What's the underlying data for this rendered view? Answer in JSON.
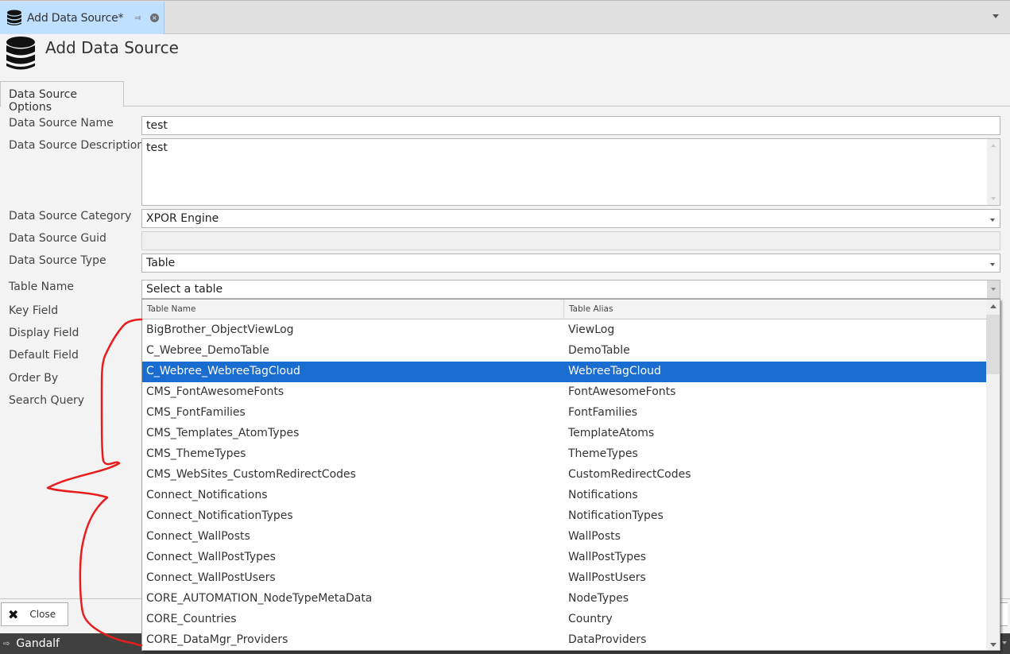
{
  "window_tab": {
    "label": "Add Data Source*",
    "icon": "database-icon",
    "pin_icon": "pin-icon",
    "close_icon": "close-circle-icon",
    "menu_icon": "chevron-down-icon"
  },
  "header": {
    "title": "Add Data Source",
    "icon": "database-icon"
  },
  "tabs": [
    {
      "label": "Data Source Options",
      "active": true
    }
  ],
  "form": {
    "name": {
      "label": "Data Source Name",
      "value": "test"
    },
    "description": {
      "label": "Data Source Description",
      "value": "test"
    },
    "category": {
      "label": "Data Source Category",
      "value": "XPOR Engine"
    },
    "guid": {
      "label": "Data Source Guid",
      "value": ""
    },
    "type": {
      "label": "Data Source Type",
      "value": "Table"
    },
    "table_name": {
      "label": "Table Name",
      "placeholder": "Select a table"
    },
    "key_field": {
      "label": "Key Field"
    },
    "display_field": {
      "label": "Display Field"
    },
    "default_field": {
      "label": "Default Field"
    },
    "order_by": {
      "label": "Order By"
    },
    "search_query": {
      "label": "Search Query"
    }
  },
  "table_dropdown": {
    "columns": [
      "Table Name",
      "Table Alias"
    ],
    "selected_index": 2,
    "selection_color": "#1a6dd0",
    "rows": [
      [
        "BigBrother_ObjectViewLog",
        "ViewLog"
      ],
      [
        "C_Webree_DemoTable",
        "DemoTable"
      ],
      [
        "C_Webree_WebreeTagCloud",
        "WebreeTagCloud"
      ],
      [
        "CMS_FontAwesomeFonts",
        "FontAwesomeFonts"
      ],
      [
        "CMS_FontFamilies",
        "FontFamilies"
      ],
      [
        "CMS_Templates_AtomTypes",
        "TemplateAtoms"
      ],
      [
        "CMS_ThemeTypes",
        "ThemeTypes"
      ],
      [
        "CMS_WebSites_CustomRedirectCodes",
        "CustomRedirectCodes"
      ],
      [
        "Connect_Notifications",
        "Notifications"
      ],
      [
        "Connect_NotificationTypes",
        "NotificationTypes"
      ],
      [
        "Connect_WallPosts",
        "WallPosts"
      ],
      [
        "Connect_WallPostTypes",
        "WallPostTypes"
      ],
      [
        "Connect_WallPostUsers",
        "WallPostUsers"
      ],
      [
        "CORE_AUTOMATION_NodeTypeMetaData",
        "NodeTypes"
      ],
      [
        "CORE_Countries",
        "Country"
      ],
      [
        "CORE_DataMgr_Providers",
        "DataProviders"
      ]
    ]
  },
  "footer": {
    "close_label": "Close",
    "close_icon": "x-icon"
  },
  "status_bar": {
    "user": "Gandalf",
    "icon": "logout-icon",
    "background": "#404040"
  },
  "annotation": {
    "type": "red hand-drawn brace",
    "color": "#e81c1c"
  }
}
